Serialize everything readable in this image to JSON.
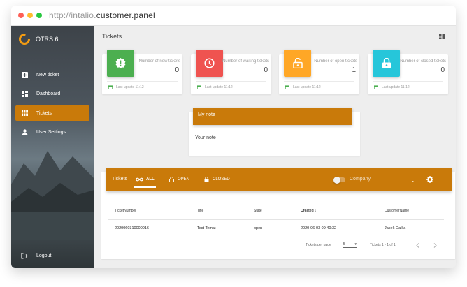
{
  "browser": {
    "url_prefix": "http://intalio.",
    "url_host": "customer.panel"
  },
  "sidebar": {
    "app_name": "OTRS 6",
    "items": [
      {
        "label": "New ticket",
        "icon": "plus-box-icon"
      },
      {
        "label": "Dashboard",
        "icon": "dashboard-icon"
      },
      {
        "label": "Tickets",
        "icon": "view-list-icon",
        "active": true
      },
      {
        "label": "User Settings",
        "icon": "user-icon"
      }
    ],
    "logout_label": "Logout"
  },
  "header": {
    "title": "Tickets"
  },
  "stats": [
    {
      "label": "Number of new tickets",
      "value": "0",
      "color": "#4caf50",
      "icon": "alert-badge-icon",
      "updated": "Last update 11:12"
    },
    {
      "label": "Number of waiting tickets",
      "value": "0",
      "color": "#ef5350",
      "icon": "clock-icon",
      "updated": "Last update 11:12"
    },
    {
      "label": "Number of open tickets",
      "value": "1",
      "color": "#ffa726",
      "icon": "lock-open-icon",
      "updated": "Last update 11:12"
    },
    {
      "label": "Number of closed tickets",
      "value": "0",
      "color": "#26c6da",
      "icon": "lock-icon",
      "updated": "Last update 11:12"
    }
  ],
  "note": {
    "title": "My note",
    "placeholder": "Your note"
  },
  "tickets": {
    "bar_title": "Tickets",
    "tabs": [
      "ALL",
      "OPEN",
      "CLOSED"
    ],
    "toggle_label": "Company",
    "columns": [
      "TicketNumber",
      "Title",
      "State",
      "Created",
      "CustomerName"
    ],
    "rows": [
      [
        "2020060310000016",
        "Test Temat",
        "open",
        "2020-06-03 09:40:32",
        "Jacek Galka"
      ]
    ],
    "per_page_label": "Tickets per page",
    "per_page_value": "5",
    "range_label": "Tickets 1 - 1 of 1"
  },
  "colors": {
    "accent": "#c97a0a"
  }
}
